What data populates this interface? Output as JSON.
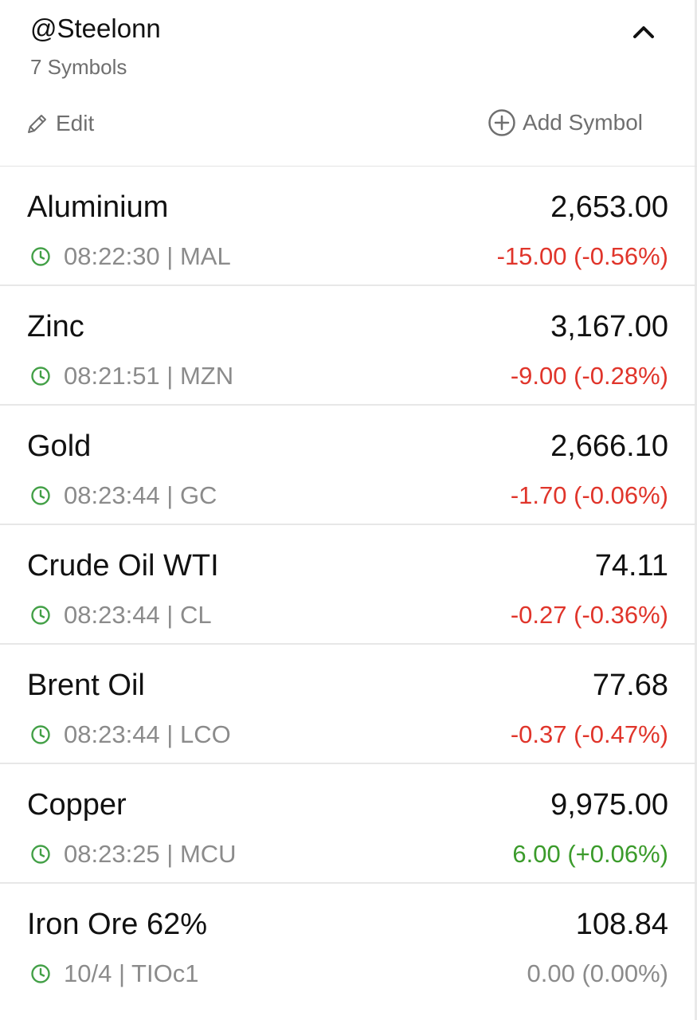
{
  "header": {
    "title": "@Steelonn",
    "subtitle": "7 Symbols",
    "edit_label": "Edit",
    "add_label": "Add Symbol"
  },
  "colors": {
    "negative": "#e0352b",
    "positive": "#3b9b2b",
    "neutral": "#8b8b8b",
    "clock": "#43a047"
  },
  "icons": {
    "collapse": "chevron-up-icon",
    "edit": "pencil-icon",
    "add": "plus-circle-icon",
    "time": "clock-icon"
  },
  "symbols": [
    {
      "name": "Aluminium",
      "price": "2,653.00",
      "time": "08:22:30",
      "ticker": "MAL",
      "change": "-15.00 (-0.56%)",
      "direction": "negative"
    },
    {
      "name": "Zinc",
      "price": "3,167.00",
      "time": "08:21:51",
      "ticker": "MZN",
      "change": "-9.00 (-0.28%)",
      "direction": "negative"
    },
    {
      "name": "Gold",
      "price": "2,666.10",
      "time": "08:23:44",
      "ticker": "GC",
      "change": "-1.70 (-0.06%)",
      "direction": "negative"
    },
    {
      "name": "Crude Oil WTI",
      "price": "74.11",
      "time": "08:23:44",
      "ticker": "CL",
      "change": "-0.27 (-0.36%)",
      "direction": "negative"
    },
    {
      "name": "Brent Oil",
      "price": "77.68",
      "time": "08:23:44",
      "ticker": "LCO",
      "change": "-0.37 (-0.47%)",
      "direction": "negative"
    },
    {
      "name": "Copper",
      "price": "9,975.00",
      "time": "08:23:25",
      "ticker": "MCU",
      "change": "6.00 (+0.06%)",
      "direction": "positive"
    },
    {
      "name": "Iron Ore 62%",
      "price": "108.84",
      "time": "10/4",
      "ticker": "TIOc1",
      "change": "0.00 (0.00%)",
      "direction": "neutral"
    }
  ]
}
